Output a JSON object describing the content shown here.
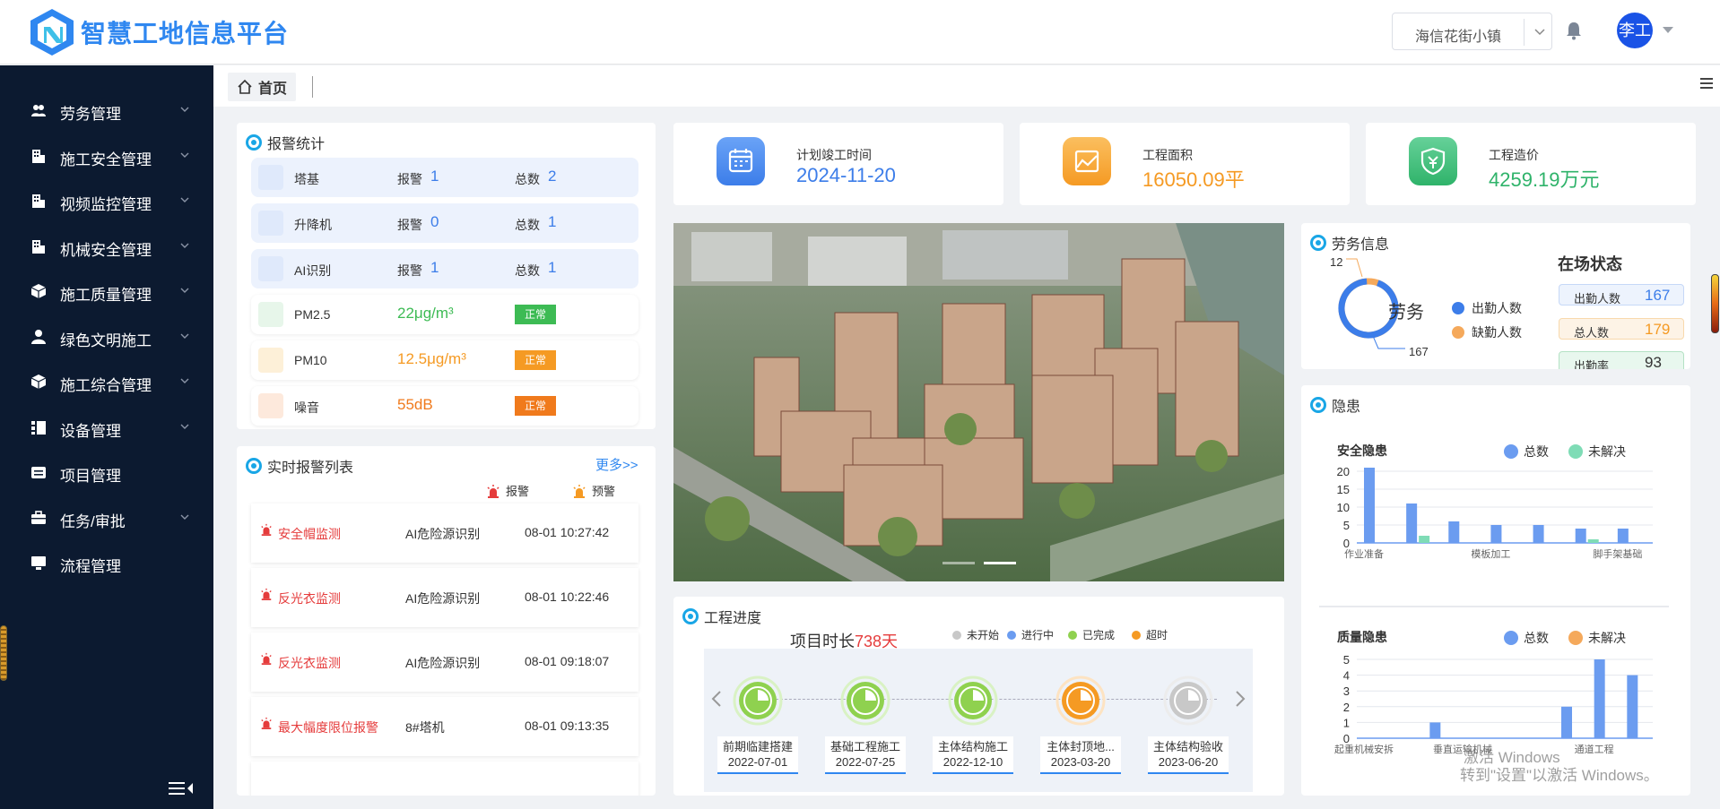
{
  "header": {
    "app_title": "智慧工地信息平台",
    "project": "海信花街小镇",
    "user": "李工"
  },
  "sidebar": {
    "items": [
      {
        "label": "劳务管理",
        "icon": "users-icon",
        "has_children": true
      },
      {
        "label": "施工安全管理",
        "icon": "building-icon",
        "has_children": true
      },
      {
        "label": "视频监控管理",
        "icon": "building-icon",
        "has_children": true
      },
      {
        "label": "机械安全管理",
        "icon": "building-icon",
        "has_children": true
      },
      {
        "label": "施工质量管理",
        "icon": "cube-icon",
        "has_children": true
      },
      {
        "label": "绿色文明施工",
        "icon": "user-icon",
        "has_children": true
      },
      {
        "label": "施工综合管理",
        "icon": "cube-icon",
        "has_children": true
      },
      {
        "label": "设备管理",
        "icon": "list-icon",
        "has_children": true
      },
      {
        "label": "项目管理",
        "icon": "card-icon",
        "has_children": false
      },
      {
        "label": "任务/审批",
        "icon": "briefcase-icon",
        "has_children": true
      },
      {
        "label": "流程管理",
        "icon": "monitor-icon",
        "has_children": false
      }
    ]
  },
  "tabs": {
    "home": "首页"
  },
  "alarm_stats": {
    "title": "报警统计",
    "alarm_label": "报警",
    "total_label": "总数",
    "equipment": [
      {
        "name": "塔基",
        "alarm": "1",
        "total": "2"
      },
      {
        "name": "升降机",
        "alarm": "0",
        "total": "1"
      },
      {
        "name": "AI识别",
        "alarm": "1",
        "total": "1"
      }
    ],
    "environment": [
      {
        "name": "PM2.5",
        "value": "22μg/m³",
        "status": "正常",
        "color": "#3dbb54"
      },
      {
        "name": "PM10",
        "value": "12.5μg/m³",
        "status": "正常",
        "color": "#f59a23"
      },
      {
        "name": "噪音",
        "value": "55dB",
        "status": "正常",
        "color": "#f07a1c"
      }
    ]
  },
  "realtime_alarms": {
    "title": "实时报警列表",
    "more": "更多>>",
    "legend_alarm": "报警",
    "legend_warning": "预警",
    "rows": [
      {
        "name": "安全帽监测",
        "source": "AI危险源识别",
        "time": "08-01 10:27:42"
      },
      {
        "name": "反光衣监测",
        "source": "AI危险源识别",
        "time": "08-01 10:22:46"
      },
      {
        "name": "反光衣监测",
        "source": "AI危险源识别",
        "time": "08-01 09:18:07"
      },
      {
        "name": "最大幅度限位报警",
        "source": "8#塔机",
        "time": "08-01 09:13:35"
      }
    ]
  },
  "kpis": [
    {
      "label": "计划竣工时间",
      "value": "2024-11-20",
      "color": "#3c7de9"
    },
    {
      "label": "工程面积",
      "value": "16050.09平",
      "color": "#f59a23"
    },
    {
      "label": "工程造价",
      "value": "4259.19万元",
      "color": "#2fb36a"
    }
  ],
  "progress": {
    "title": "工程进度",
    "duration_label": "项目时长",
    "duration_value": "738天",
    "legend": [
      {
        "label": "未开始",
        "color": "#c8c8c8"
      },
      {
        "label": "进行中",
        "color": "#6b9cf0"
      },
      {
        "label": "已完成",
        "color": "#8fd14f"
      },
      {
        "label": "超时",
        "color": "#f59a23"
      }
    ],
    "milestones": [
      {
        "name": "前期临建搭建",
        "date": "2022-07-01",
        "status": "done"
      },
      {
        "name": "基础工程施工",
        "date": "2022-07-25",
        "status": "done"
      },
      {
        "name": "主体结构施工",
        "date": "2022-12-10",
        "status": "done"
      },
      {
        "name": "主体封顶地...",
        "date": "2023-03-20",
        "status": "overtime"
      },
      {
        "name": "主体结构验收",
        "date": "2023-06-20",
        "status": "not_started"
      }
    ]
  },
  "labour": {
    "title": "劳务信息",
    "donut_label": "劳务",
    "absent_value": "12",
    "present_value": "167",
    "legend_present": "出勤人数",
    "legend_absent": "缺勤人数",
    "status_title": "在场状态",
    "status": [
      {
        "label": "出勤人数",
        "value": "167",
        "color": "#3c7de9"
      },
      {
        "label": "总人数",
        "value": "179",
        "color": "#f59a23"
      },
      {
        "label": "出勤率",
        "value": "93",
        "color": "#333333"
      }
    ]
  },
  "hazards": {
    "title": "隐患",
    "legend_total": "总数",
    "legend_unresolved": "未解决"
  },
  "chart_data": [
    {
      "type": "bar",
      "title": "安全隐患",
      "categories": [
        "作业准备",
        "",
        "",
        "模板加工",
        "",
        "",
        "脚手架基础"
      ],
      "series": [
        {
          "name": "总数",
          "values": [
            21,
            11,
            6,
            5,
            5,
            4,
            4
          ]
        },
        {
          "name": "未解决",
          "values": [
            0,
            2,
            0,
            0,
            0,
            1,
            0
          ]
        }
      ],
      "ylim": [
        0,
        20
      ],
      "yticks": [
        "20",
        "15",
        "10",
        "5",
        "0"
      ],
      "colors": [
        "#6b9cf0",
        "#7fdcb6"
      ]
    },
    {
      "type": "bar",
      "title": "质量隐患",
      "categories": [
        "起重机械安拆",
        "",
        "",
        "垂直运输机械",
        "",
        "",
        "",
        "通道工程"
      ],
      "series": [
        {
          "name": "总数",
          "values": [
            0,
            0,
            1,
            0,
            0,
            0,
            2,
            5,
            4
          ]
        },
        {
          "name": "未解决",
          "values": [
            0,
            0,
            0,
            0,
            0,
            0,
            0,
            0,
            0
          ]
        }
      ],
      "ylim": [
        0,
        5
      ],
      "yticks": [
        "5",
        "4",
        "3",
        "2",
        "1",
        "0"
      ],
      "colors": [
        "#6b9cf0",
        "#f5a95b"
      ]
    }
  ],
  "watermark": {
    "line1": "激活 Windows",
    "line2": "转到\"设置\"以激活 Windows。"
  }
}
